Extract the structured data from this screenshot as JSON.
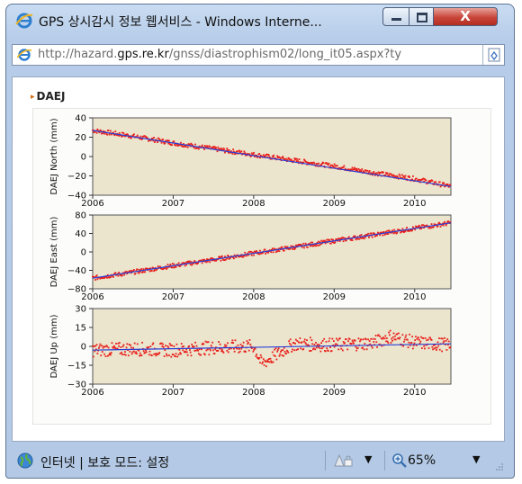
{
  "window": {
    "title": "GPS 상시감시 정보 웹서비스 - Windows Interne...",
    "close_label": "X"
  },
  "address": {
    "url_prefix": "http://hazard.",
    "url_domain": "gps.re.kr",
    "url_path": "/gnss/diastrophism02/long_it05.aspx?ty"
  },
  "page": {
    "heading": "DAEJ"
  },
  "status": {
    "zone_text": "인터넷 | 보호 모드: 설정",
    "zoom_text": "65%"
  },
  "colors": {
    "plot_bg": "#ece5ce",
    "points": "#e8201a",
    "trend": "#2a3fd8"
  },
  "chart_data": [
    {
      "type": "scatter",
      "ylabel": "DAEJ North (mm)",
      "xlim": [
        2006,
        2010.45
      ],
      "ylim": [
        -40,
        40
      ],
      "x_ticks": [
        "2006",
        "2007",
        "2008",
        "2009",
        "2010"
      ],
      "y_ticks": [
        "40",
        "20",
        "0",
        "−20",
        "−40"
      ],
      "y_tick_values": [
        40,
        20,
        0,
        -20,
        -40
      ],
      "trend": {
        "x": [
          2006,
          2010.45
        ],
        "y": [
          27,
          -31
        ]
      },
      "series": [
        {
          "x": [
            2006.0,
            2006.5,
            2007.0,
            2007.5,
            2008.0,
            2008.5,
            2009.0,
            2009.5,
            2010.0,
            2010.45
          ],
          "y": [
            27,
            21,
            14,
            8,
            2,
            -4,
            -10,
            -17,
            -23,
            -31
          ]
        }
      ]
    },
    {
      "type": "scatter",
      "ylabel": "DAEJ East (mm)",
      "xlim": [
        2006,
        2010.45
      ],
      "ylim": [
        -80,
        80
      ],
      "x_ticks": [
        "2006",
        "2007",
        "2008",
        "2009",
        "2010"
      ],
      "y_ticks": [
        "80",
        "40",
        "0",
        "−40",
        "−80"
      ],
      "y_tick_values": [
        80,
        40,
        0,
        -40,
        -80
      ],
      "trend": {
        "x": [
          2006,
          2010.45
        ],
        "y": [
          -57,
          63
        ]
      },
      "series": [
        {
          "x": [
            2006.0,
            2006.5,
            2007.0,
            2007.5,
            2008.0,
            2008.5,
            2009.0,
            2009.5,
            2010.0,
            2010.45
          ],
          "y": [
            -57,
            -44,
            -30,
            -17,
            -3,
            10,
            24,
            37,
            51,
            63
          ]
        }
      ]
    },
    {
      "type": "scatter",
      "ylabel": "DAEJ Up (mm)",
      "xlim": [
        2006,
        2010.45
      ],
      "ylim": [
        -30,
        30
      ],
      "x_ticks": [
        "2006",
        "2007",
        "2008",
        "2009",
        "2010"
      ],
      "y_ticks": [
        "30",
        "15",
        "0",
        "−15",
        "−30"
      ],
      "y_tick_values": [
        30,
        15,
        0,
        -15,
        -30
      ],
      "trend": {
        "x": [
          2006,
          2010.45
        ],
        "y": [
          -3,
          2
        ]
      },
      "series": [
        {
          "x": [
            2006.0,
            2006.5,
            2007.0,
            2007.5,
            2008.0,
            2008.1,
            2008.5,
            2009.0,
            2009.5,
            2009.7,
            2010.0,
            2010.45
          ],
          "y": [
            -3,
            -2,
            -3,
            -1,
            0,
            -14,
            2,
            1,
            3,
            8,
            3,
            1
          ]
        }
      ]
    }
  ]
}
